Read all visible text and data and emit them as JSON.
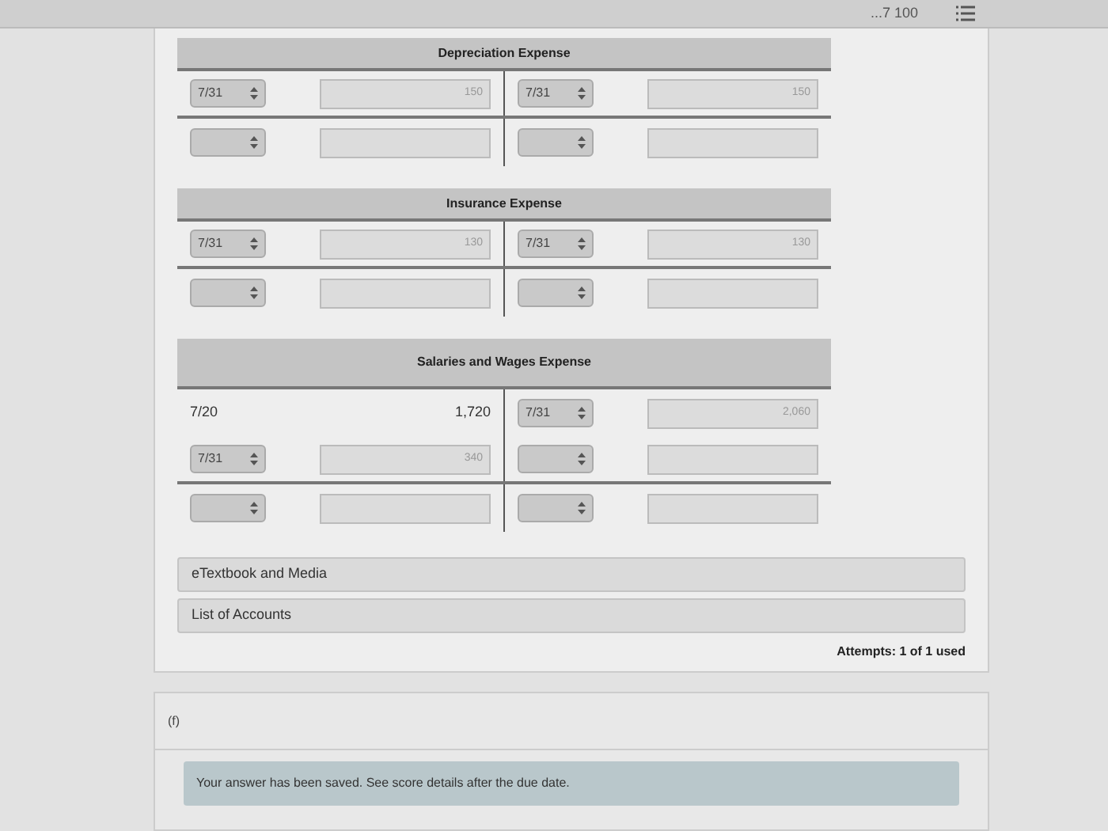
{
  "top_bar": {
    "score": "...7 100"
  },
  "accounts": [
    {
      "title": "Depreciation Expense",
      "rows": [
        {
          "ruled_below": true,
          "left": {
            "kind": "entry",
            "date": "7/31",
            "amount": "150"
          },
          "right": {
            "kind": "entry",
            "date": "7/31",
            "amount": "150"
          }
        },
        {
          "ruled_below": false,
          "left": {
            "kind": "entry"
          },
          "right": {
            "kind": "entry"
          }
        }
      ]
    },
    {
      "title": "Insurance Expense",
      "rows": [
        {
          "ruled_below": true,
          "left": {
            "kind": "entry",
            "date": "7/31",
            "amount": "130"
          },
          "right": {
            "kind": "entry",
            "date": "7/31",
            "amount": "130"
          }
        },
        {
          "ruled_below": false,
          "left": {
            "kind": "entry"
          },
          "right": {
            "kind": "entry"
          }
        }
      ]
    },
    {
      "title": "Salaries and Wages Expense",
      "rows": [
        {
          "ruled_below": false,
          "left": {
            "kind": "plain",
            "date": "7/20",
            "amount": "1,720"
          },
          "right": {
            "kind": "entry",
            "date": "7/31",
            "amount": "2,060"
          }
        },
        {
          "ruled_below": true,
          "left": {
            "kind": "entry",
            "date": "7/31",
            "amount": "340"
          },
          "right": {
            "kind": "entry"
          }
        },
        {
          "ruled_below": false,
          "left": {
            "kind": "entry"
          },
          "right": {
            "kind": "entry"
          }
        }
      ]
    }
  ],
  "links": [
    "eTextbook and Media",
    "List of Accounts"
  ],
  "attempts": "Attempts: 1 of 1 used",
  "next_part": {
    "label": "(f)",
    "message": "Your answer has been saved. See score details after the due date."
  }
}
